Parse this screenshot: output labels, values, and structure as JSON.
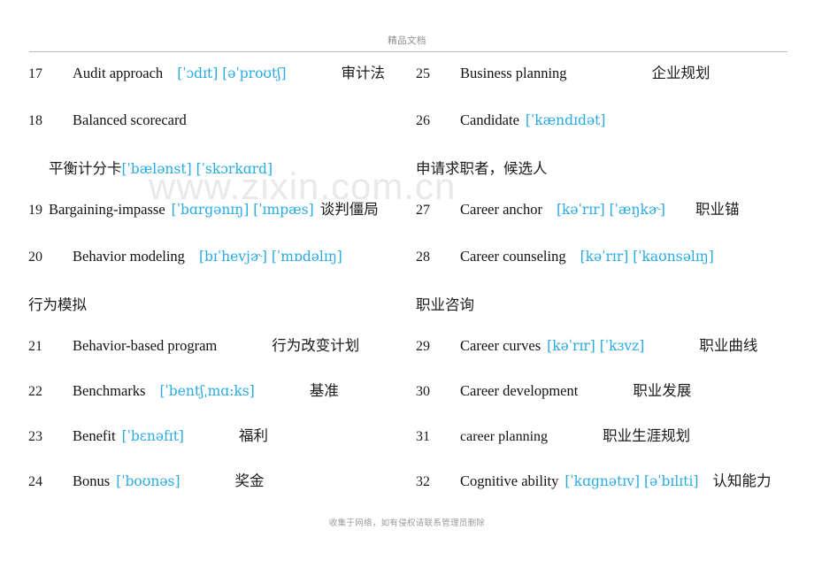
{
  "header": {
    "title": "精品文档"
  },
  "footer": {
    "note": "收集于网络，如有侵权请联系管理员删除"
  },
  "watermark": {
    "text": "www.zixin.com.cn"
  },
  "colors": {
    "ipa_blue": "#29abe2",
    "text_black": "#111111",
    "header_gray": "#8d8d8d",
    "rule_gray": "#b9b9b9",
    "watermark_gray": "#e9e9e9"
  },
  "columns": {
    "left": [
      {
        "num": "17",
        "term": "Audit approach",
        "ipa": "[ˈɔdɪt] [əˈproʊtʃ]",
        "cn": "审计法",
        "cont": ""
      },
      {
        "num": "18",
        "term": "Balanced scorecard",
        "ipa": "",
        "cn": "",
        "cont_cn": "平衡计分卡",
        "cont_ipa": "[ˈbælənst] [ˈskɔrkɑrd]"
      },
      {
        "num": "19",
        "term": "Bargaining-impasse",
        "ipa": "[ˈbɑrgənɪŋ] [ˈɪmpæs]",
        "cn": "谈判僵局",
        "cont": ""
      },
      {
        "num": "20",
        "term": "Behavior modeling",
        "ipa": "[bɪˈhevjɚ] [ˈmɒdəlɪŋ]",
        "cn": "",
        "cont_cn": "行为模拟",
        "cont_ipa": ""
      },
      {
        "num": "21",
        "term": "Behavior-based program",
        "ipa": "",
        "cn": "行为改变计划",
        "cont": ""
      },
      {
        "num": "22",
        "term": "Benchmarks",
        "ipa": "[ˈbentʃˌmɑ:ks]",
        "cn": "基准",
        "cont": ""
      },
      {
        "num": "23",
        "term": "Benefit",
        "ipa": "[ˈbɛnəfɪt]",
        "cn": "福利",
        "cont": ""
      },
      {
        "num": "24",
        "term": "Bonus",
        "ipa": "[ˈboʊnəs]",
        "cn": "奖金",
        "cont": ""
      }
    ],
    "right": [
      {
        "num": "25",
        "term": "Business planning",
        "ipa": "",
        "cn": "企业规划",
        "cont": ""
      },
      {
        "num": "26",
        "term": "Candidate",
        "ipa": "[ˈkændɪdət]",
        "cn": "",
        "cont_cn": "申请求职者，候选人",
        "cont_ipa": ""
      },
      {
        "num": "27",
        "term": "Career anchor",
        "ipa": "[kəˈrɪr] [ˈæŋkɚ]",
        "cn": "职业锚",
        "cont": ""
      },
      {
        "num": "28",
        "term": "Career counseling",
        "ipa": "[kəˈrɪr] [ˈkaʊnsəlɪŋ]",
        "cn": "",
        "cont_cn": "职业咨询",
        "cont_ipa": ""
      },
      {
        "num": "29",
        "term": "Career curves",
        "ipa": "[kəˈrɪr] [ˈkɜvz]",
        "cn": "职业曲线",
        "cont": ""
      },
      {
        "num": "30",
        "term": "Career development",
        "ipa": "",
        "cn": "职业发展",
        "cont": ""
      },
      {
        "num": "31",
        "term": "career planning",
        "ipa": "",
        "cn": "职业生涯规划",
        "cont": ""
      },
      {
        "num": "32",
        "term": "Cognitive ability",
        "ipa": "[ˈkɑgnətɪv] [əˈbɪlɪti]",
        "cn": "认知能力",
        "cont": ""
      }
    ]
  }
}
